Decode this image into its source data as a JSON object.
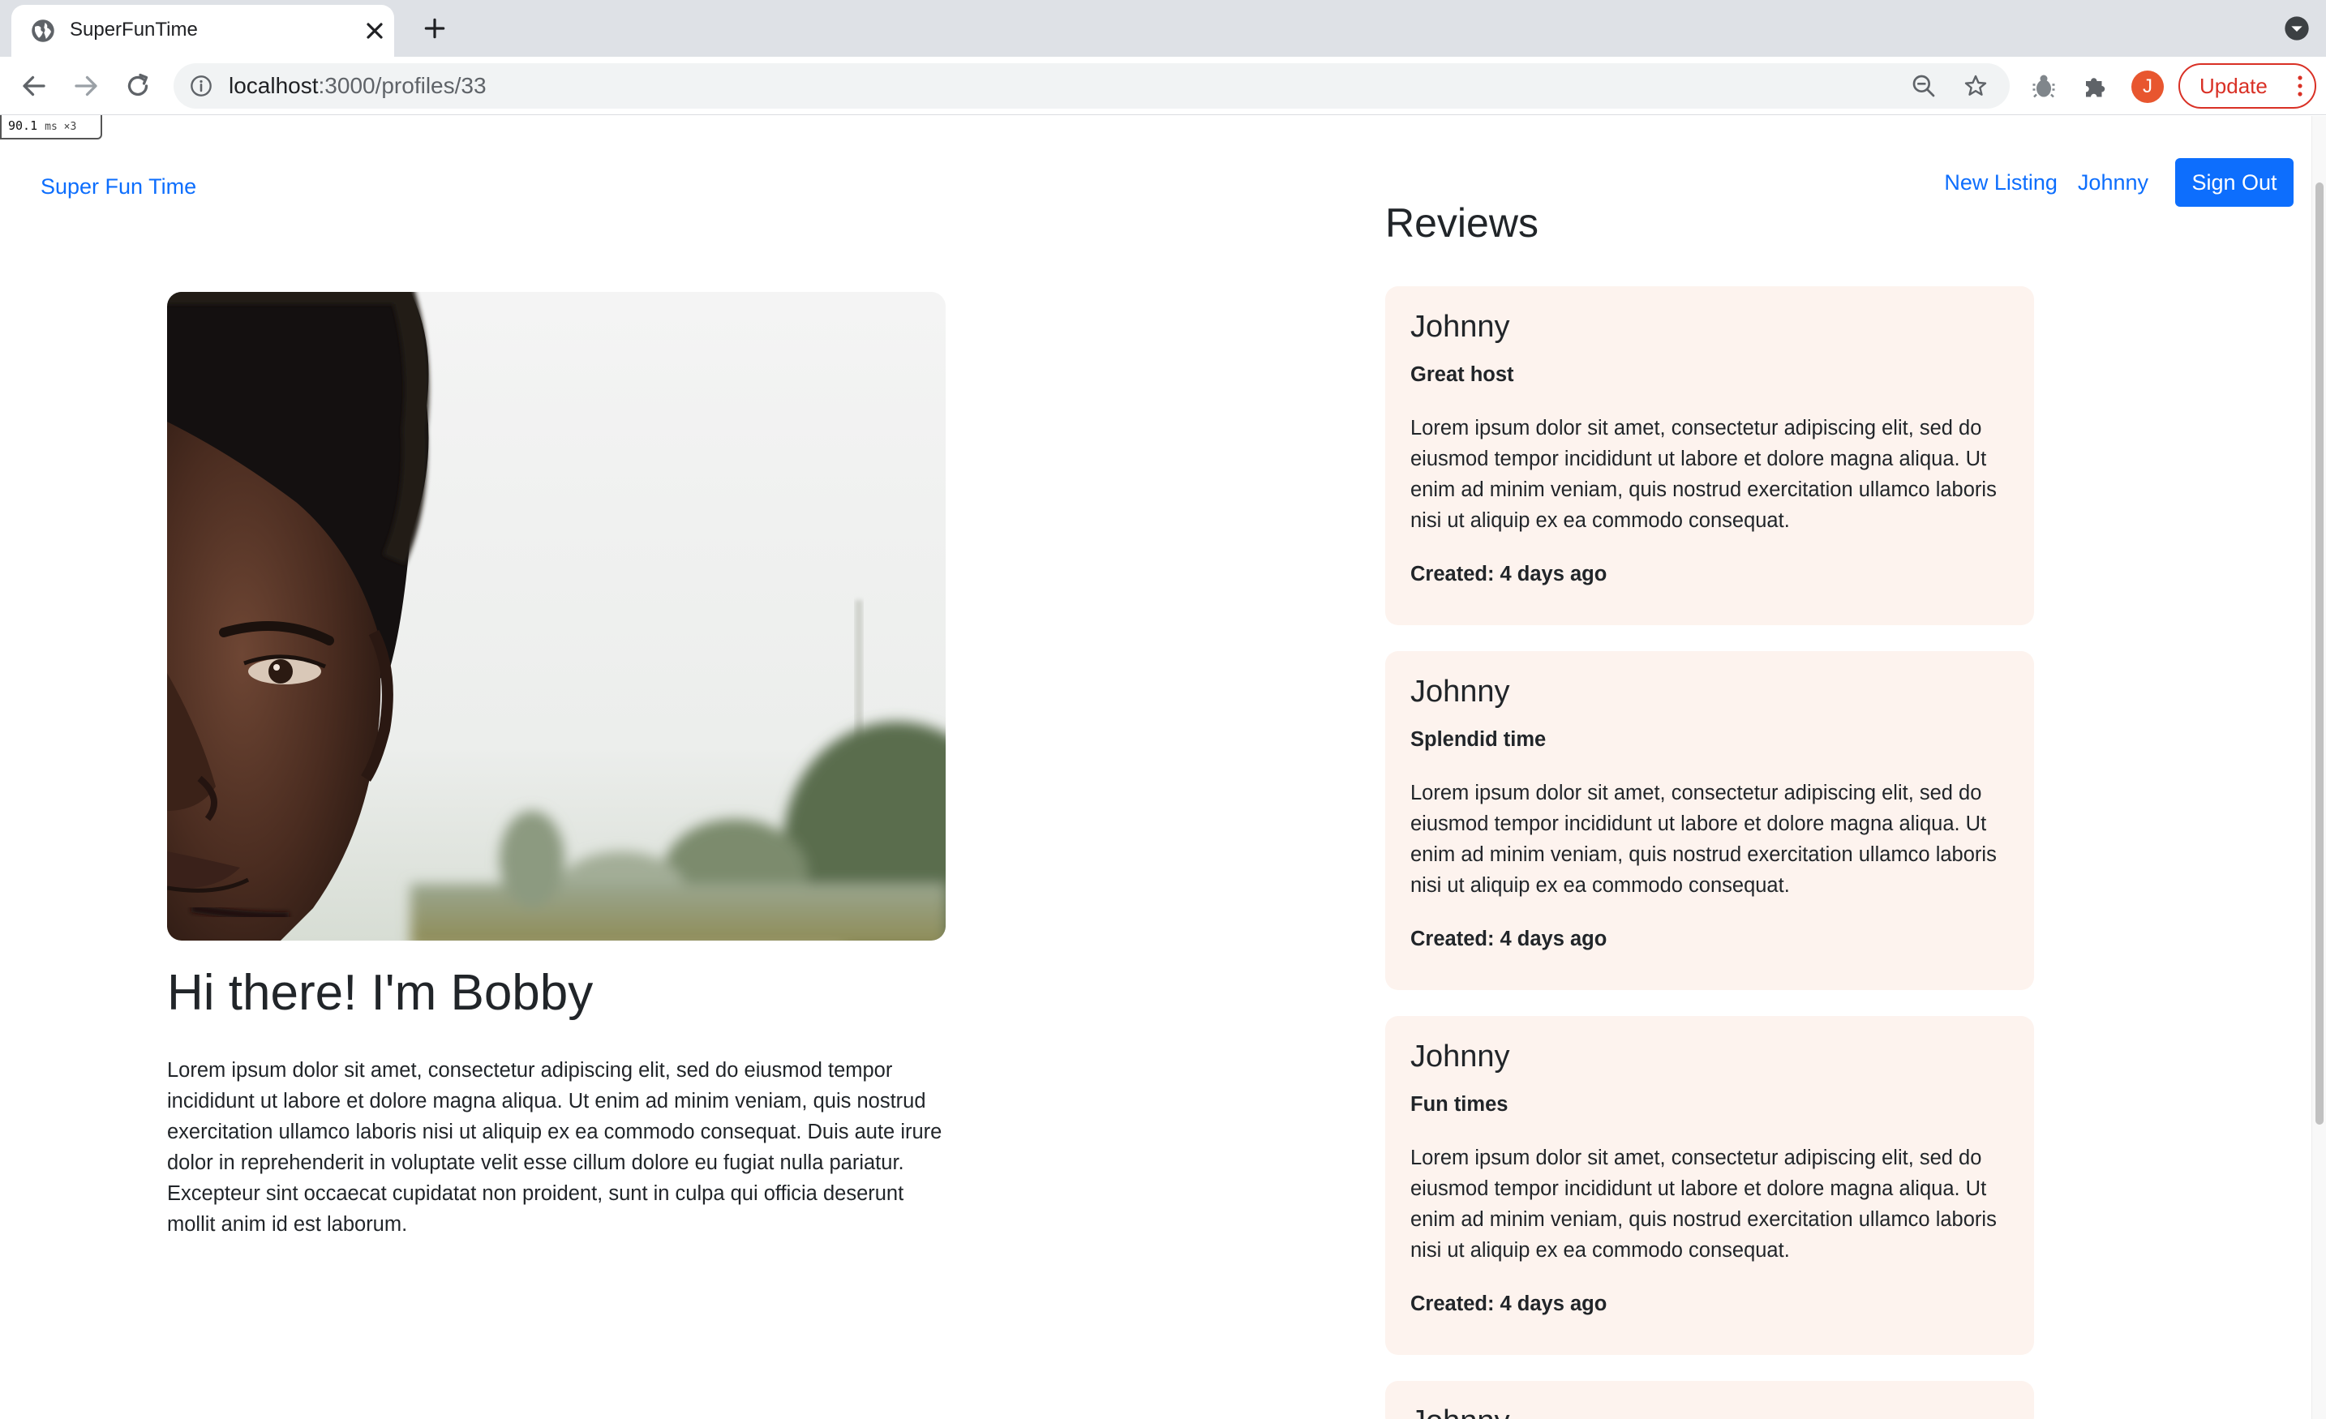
{
  "browser": {
    "tab_title": "SuperFunTime",
    "url_host": "localhost",
    "url_path": ":3000/profiles/33",
    "avatar_letter": "J",
    "update_label": "Update",
    "perf_value": "90.1",
    "perf_unit": "ms ×3"
  },
  "nav": {
    "brand": "Super Fun Time",
    "new_listing": "New Listing",
    "user": "Johnny",
    "sign_out": "Sign Out"
  },
  "profile": {
    "heading": "Hi there! I'm Bobby",
    "bio": "Lorem ipsum dolor sit amet, consectetur adipiscing elit, sed do eiusmod tempor incididunt ut labore et dolore magna aliqua. Ut enim ad minim veniam, quis nostrud exercitation ullamco laboris nisi ut aliquip ex ea commodo consequat. Duis aute irure dolor in reprehenderit in voluptate velit esse cillum dolore eu fugiat nulla pariatur. Excepteur sint occaecat cupidatat non proident, sunt in culpa qui officia deserunt mollit anim id est laborum."
  },
  "reviews": {
    "title": "Reviews",
    "items": [
      {
        "author": "Johnny",
        "title": "Great host",
        "body": "Lorem ipsum dolor sit amet, consectetur adipiscing elit, sed do eiusmod tempor incididunt ut labore et dolore magna aliqua. Ut enim ad minim veniam, quis nostrud exercitation ullamco laboris nisi ut aliquip ex ea commodo consequat.",
        "created": "Created: 4 days ago"
      },
      {
        "author": "Johnny",
        "title": "Splendid time",
        "body": "Lorem ipsum dolor sit amet, consectetur adipiscing elit, sed do eiusmod tempor incididunt ut labore et dolore magna aliqua. Ut enim ad minim veniam, quis nostrud exercitation ullamco laboris nisi ut aliquip ex ea commodo consequat.",
        "created": "Created: 4 days ago"
      },
      {
        "author": "Johnny",
        "title": "Fun times",
        "body": "Lorem ipsum dolor sit amet, consectetur adipiscing elit, sed do eiusmod tempor incididunt ut labore et dolore magna aliqua. Ut enim ad minim veniam, quis nostrud exercitation ullamco laboris nisi ut aliquip ex ea commodo consequat.",
        "created": "Created: 4 days ago"
      },
      {
        "author": "Johnny"
      }
    ]
  },
  "colors": {
    "link": "#0d6efd",
    "review_card_bg": "#fdf3ee",
    "update_red": "#d93025",
    "avatar_orange": "#e8562f"
  },
  "icons": {
    "tab_favicon": "globe-icon",
    "tab_close": "close-icon",
    "new_tab": "plus-icon",
    "back": "back-arrow-icon",
    "forward": "forward-arrow-icon",
    "reload": "reload-icon",
    "site_info": "info-icon",
    "zoom": "zoom-out-icon",
    "bookmark": "star-icon",
    "extension_bug": "bug-icon",
    "extensions": "puzzle-icon",
    "menu": "kebab-menu-icon"
  }
}
